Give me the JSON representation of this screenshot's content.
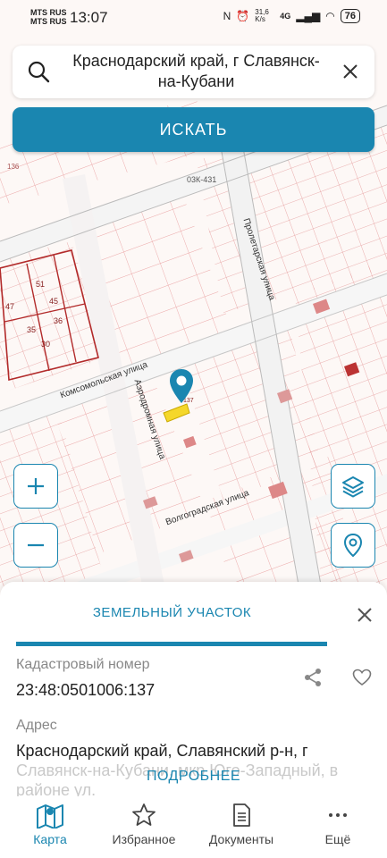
{
  "status": {
    "carrier1": "MTS RUS",
    "carrier2": "MTS RUS",
    "time": "13:07",
    "net_speed": "31,6 K/s",
    "net_type": "4G",
    "battery": "76"
  },
  "search": {
    "query": "Краснодарский край, г Славянск-на-Кубани",
    "button": "ИСКАТЬ"
  },
  "map": {
    "street_labels": [
      "Комсомольская улица",
      "Аэродромная улица",
      "Волгоградская улица",
      "Пролетарская улица",
      "03К-431"
    ],
    "parcel_numbers": [
      "136",
      "51",
      "45",
      "47",
      "36",
      "35",
      "30",
      "137"
    ]
  },
  "sheet": {
    "title": "ЗЕМЕЛЬНЫЙ УЧАСТОК",
    "cadastral_label": "Кадастровый номер",
    "cadastral_value": "23:48:0501006:137",
    "address_label": "Адрес",
    "address_line1": "Краснодарский край, Славянский р-н, г",
    "address_faded": "Славянск-на-Кубани, мкр Юго-Западный, в районе ул.",
    "more_link": "ПОДРОБНЕЕ"
  },
  "nav": {
    "items": [
      {
        "label": "Карта",
        "icon": "map-icon",
        "active": true
      },
      {
        "label": "Избранное",
        "icon": "star-icon",
        "active": false
      },
      {
        "label": "Документы",
        "icon": "document-icon",
        "active": false
      },
      {
        "label": "Ещё",
        "icon": "more-icon",
        "active": false
      }
    ]
  },
  "colors": {
    "accent": "#1a86b0",
    "parcel_line": "#e8a0a0",
    "parcel_dark": "#b22a2a",
    "highlight": "#f5d72a"
  }
}
